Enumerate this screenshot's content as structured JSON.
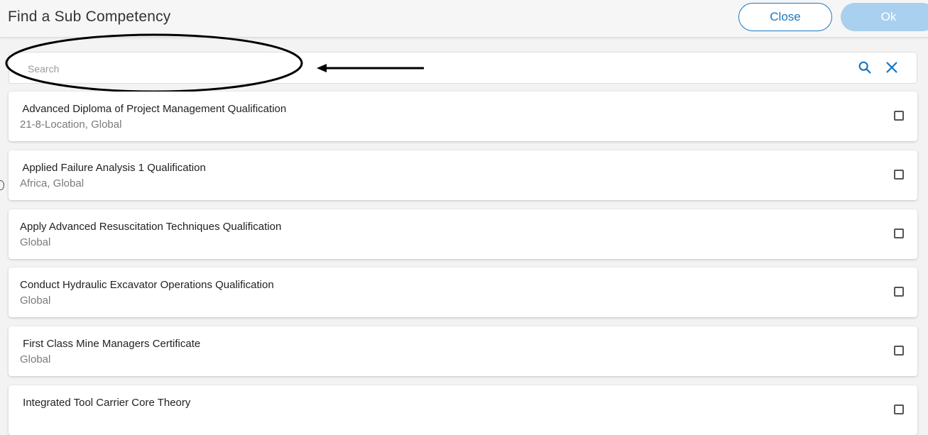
{
  "header": {
    "title": "Find a Sub Competency",
    "close_label": "Close",
    "ok_label": "Ok"
  },
  "search": {
    "placeholder": "Search",
    "value": "",
    "search_icon": "search-icon",
    "clear_icon": "close-icon"
  },
  "colors": {
    "accent": "#1a78c2",
    "ok_disabled": "#a9d0ee",
    "annotation": "#000000"
  },
  "items": [
    {
      "title": " Advanced Diploma of Project Management Qualification",
      "subtitle": "21-8-Location, Global",
      "checked": false
    },
    {
      "title": " Applied Failure Analysis 1 Qualification",
      "subtitle": "Africa, Global",
      "checked": false
    },
    {
      "title": "Apply Advanced Resuscitation Techniques Qualification",
      "subtitle": "Global",
      "checked": false
    },
    {
      "title": "Conduct Hydraulic Excavator Operations Qualification",
      "subtitle": "Global",
      "checked": false
    },
    {
      "title": " First Class Mine Managers Certificate",
      "subtitle": "Global",
      "checked": false
    },
    {
      "title": " Integrated Tool Carrier Core Theory",
      "subtitle": "",
      "checked": false
    }
  ]
}
